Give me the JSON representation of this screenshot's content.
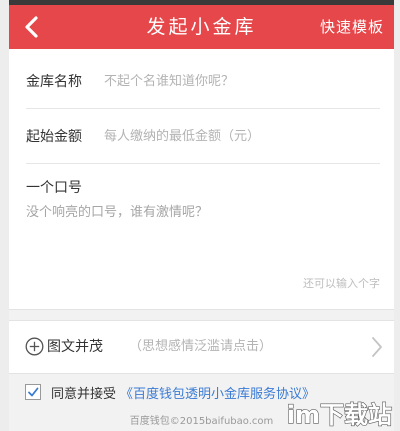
{
  "header": {
    "title": "发起小金库",
    "action_label": "快速模板",
    "accent_color": "#e5474a",
    "back_icon": "chevron-left-icon"
  },
  "form": {
    "name": {
      "label": "金库名称",
      "placeholder": "不起个名谁知道你呢？"
    },
    "amount": {
      "label": "起始金额",
      "placeholder": "每人缴纳的最低金额（元）"
    },
    "signal": {
      "label": "一个口号",
      "placeholder": "没个响亮的口号，谁有激情呢？",
      "hint": "还可以输入个字"
    }
  },
  "media": {
    "label": "图文并茂",
    "hint": "（思想感情泛滥请点击）",
    "icon": "plus-circle-icon",
    "chevron_icon": "chevron-right-icon"
  },
  "agreement": {
    "checked": true,
    "text": "同意并接受",
    "link": "《百度钱包透明小金库服务协议》",
    "link_color": "#3a7bd5"
  },
  "footer": {
    "text": "百度钱包©2015baifubao.com"
  },
  "watermark": {
    "text": "im下载站"
  }
}
